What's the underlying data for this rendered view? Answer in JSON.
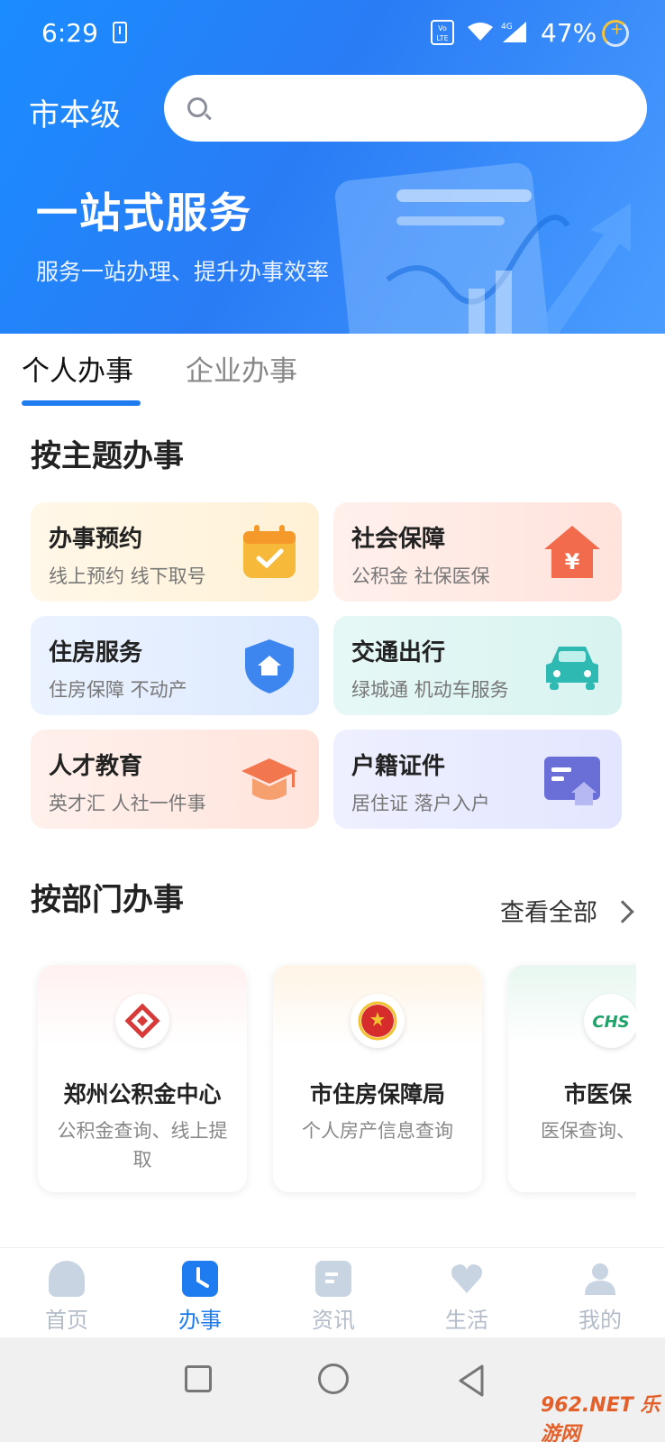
{
  "status_bar": {
    "time": "6:29",
    "network": "4G",
    "battery": "47%",
    "volte": "Vo LTE"
  },
  "header": {
    "city": "市本级",
    "search_placeholder": "",
    "slogan": "一站式服务",
    "subslogan": "服务一站办理、提升办事效率"
  },
  "tabs": [
    {
      "label": "个人办事",
      "active": true
    },
    {
      "label": "企业办事",
      "active": false
    }
  ],
  "topics": {
    "title": "按主题办事",
    "items": [
      {
        "title": "办事预约",
        "subtitle": "线上预约 线下取号",
        "icon": "calendar-icon"
      },
      {
        "title": "社会保障",
        "subtitle": "公积金 社保医保",
        "icon": "yen-house-icon"
      },
      {
        "title": "住房服务",
        "subtitle": "住房保障 不动产",
        "icon": "shield-house-icon"
      },
      {
        "title": "交通出行",
        "subtitle": "绿城通 机动车服务",
        "icon": "car-icon"
      },
      {
        "title": "人才教育",
        "subtitle": "英才汇 人社一件事",
        "icon": "graduation-cap-icon"
      },
      {
        "title": "户籍证件",
        "subtitle": "居住证 落户入户",
        "icon": "id-card-icon"
      }
    ]
  },
  "departments": {
    "title": "按部门办事",
    "view_all": "查看全部",
    "items": [
      {
        "name": "郑州公积金中心",
        "desc": "公积金查询、线上提取",
        "logo": "housing-fund-logo"
      },
      {
        "name": "市住房保障局",
        "desc": "个人房产信息查询",
        "logo": "national-emblem-logo"
      },
      {
        "name": "市医保",
        "desc": "医保查询、缴费",
        "logo": "chs-logo",
        "logo_text": "CHS"
      }
    ]
  },
  "bottom_nav": [
    {
      "label": "首页",
      "icon": "home-icon",
      "active": false
    },
    {
      "label": "办事",
      "icon": "clock-icon",
      "active": true
    },
    {
      "label": "资讯",
      "icon": "news-icon",
      "active": false
    },
    {
      "label": "生活",
      "icon": "heart-icon",
      "active": false
    },
    {
      "label": "我的",
      "icon": "user-icon",
      "active": false
    }
  ],
  "colors": {
    "primary": "#1f7cf0",
    "header_gradient_start": "#1a8cff",
    "inactive_nav": "#b3bcc8"
  },
  "watermark": "962.NET 乐游网"
}
